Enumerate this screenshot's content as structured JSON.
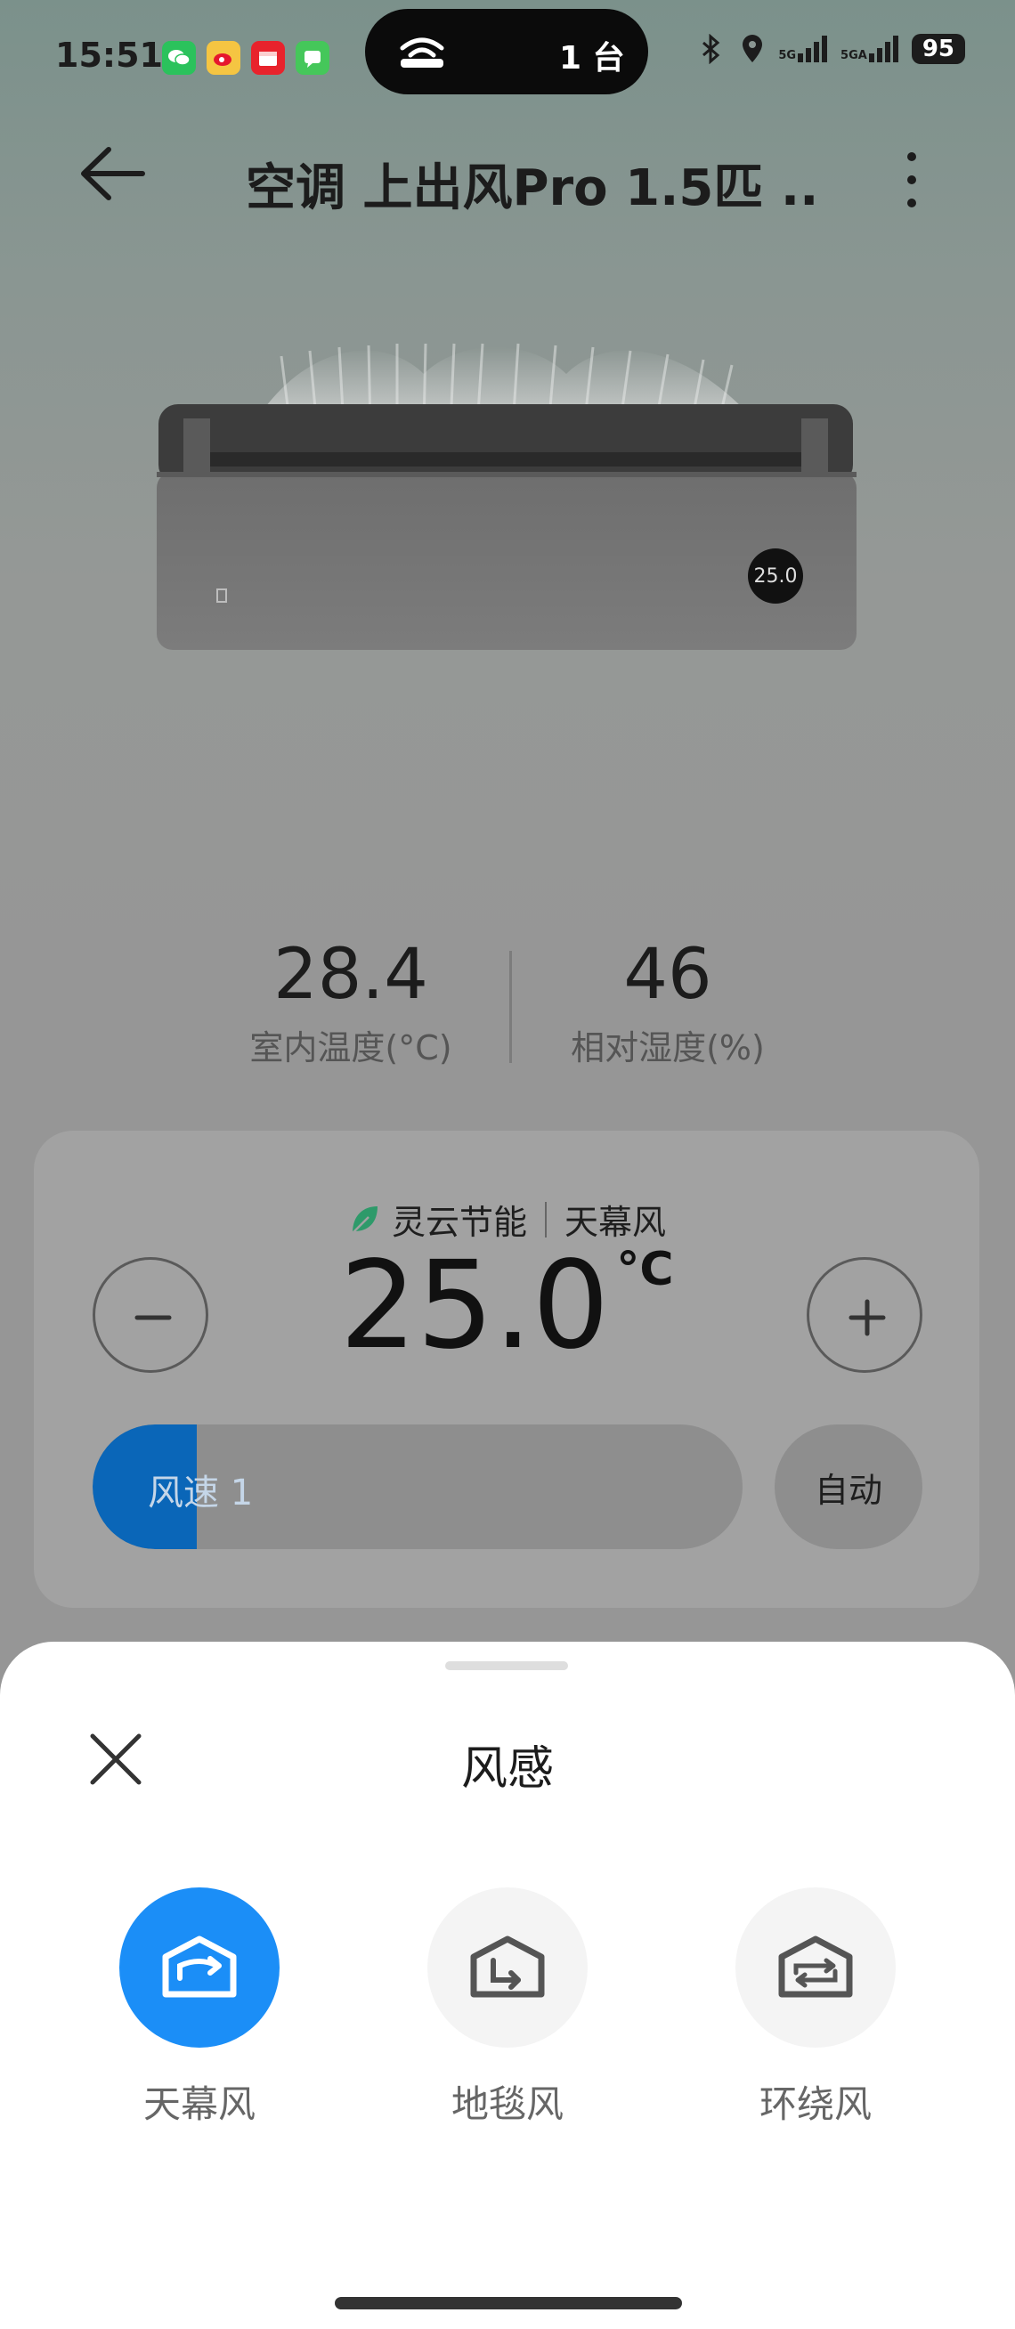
{
  "status_bar": {
    "time": "15:51",
    "island_count": "1 台",
    "signal_1": "5G",
    "signal_2": "5GA",
    "battery": "95"
  },
  "header": {
    "title": "空调 上出风Pro 1.5匹 ...",
    "back_icon": "arrow-left-icon",
    "more_icon": "more-vertical-icon"
  },
  "device": {
    "display_temp": "25.0"
  },
  "readings": {
    "indoor_temp": "28.4",
    "indoor_temp_label": "室内温度(°C)",
    "humidity": "46",
    "humidity_label": "相对湿度(%)"
  },
  "control": {
    "mode_primary": "灵云节能",
    "mode_secondary": "天幕风",
    "target_temp": "25.0",
    "temp_unit": "°C",
    "fan_speed_label": "风速 1",
    "fan_speed_fraction": 0.16,
    "auto_label": "自动"
  },
  "sheet": {
    "title": "风感",
    "options": [
      {
        "label": "天幕风",
        "icon": "ceiling-wind-icon",
        "selected": true
      },
      {
        "label": "地毯风",
        "icon": "carpet-wind-icon",
        "selected": false
      },
      {
        "label": "环绕风",
        "icon": "surround-wind-icon",
        "selected": false
      }
    ]
  },
  "colors": {
    "accent_blue": "#1b8ef7",
    "speed_fill": "#0a66b8",
    "leaf_green": "#2e9a6a"
  }
}
